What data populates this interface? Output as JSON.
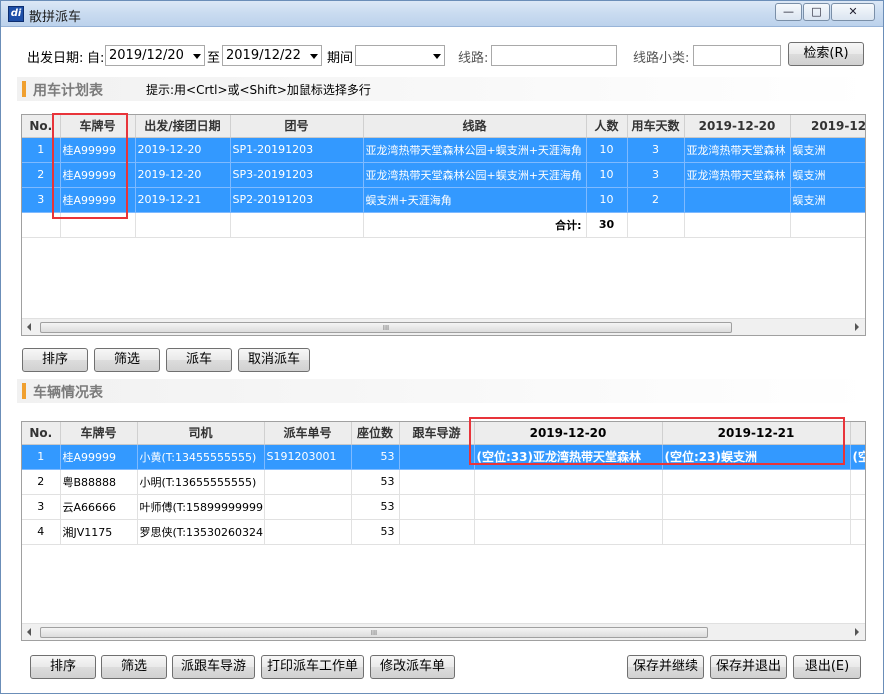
{
  "window": {
    "title": "散拼派车",
    "app_icon_text": "di",
    "minimize": "—",
    "maximize": "□",
    "close": "✕"
  },
  "filter": {
    "depart_date_label": "出发日期:",
    "from_label": "自:",
    "from_value": "2019/12/20",
    "to_label": "至",
    "to_value": "2019/12/22",
    "period_label": "期间",
    "period_value": "",
    "route_label": "线路:",
    "route_value": "",
    "route_category_label": "线路小类:",
    "route_category_value": "",
    "search_button": "检索(R)"
  },
  "plan_section": {
    "title": "用车计划表",
    "hint": "提示:用<Crtl>或<Shift>加鼠标选择多行",
    "columns": [
      "No.",
      "车牌号",
      "出发/接团日期",
      "团号",
      "线路",
      "人数",
      "用车天数",
      "2019-12-20",
      "2019-12-"
    ],
    "rows": [
      {
        "no": "1",
        "plate": "桂A99999",
        "date": "2019-12-20",
        "group": "SP1-20191203",
        "route": "亚龙湾热带天堂森林公园+蜈支洲+天涯海角",
        "people": "10",
        "days": "3",
        "d1": "亚龙湾热带天堂森林",
        "d2": "蜈支洲"
      },
      {
        "no": "2",
        "plate": "桂A99999",
        "date": "2019-12-20",
        "group": "SP3-20191203",
        "route": "亚龙湾热带天堂森林公园+蜈支洲+天涯海角",
        "people": "10",
        "days": "3",
        "d1": "亚龙湾热带天堂森林",
        "d2": "蜈支洲"
      },
      {
        "no": "3",
        "plate": "桂A99999",
        "date": "2019-12-21",
        "group": "SP2-20191203",
        "route": "蜈支洲+天涯海角",
        "people": "10",
        "days": "2",
        "d1": "",
        "d2": "蜈支洲"
      }
    ],
    "total_label": "合计:",
    "total_value": "30",
    "buttons": {
      "sort": "排序",
      "filter": "筛选",
      "dispatch": "派车",
      "cancel_dispatch": "取消派车"
    }
  },
  "vehicle_section": {
    "title": "车辆情况表",
    "columns": [
      "No.",
      "车牌号",
      "司机",
      "派车单号",
      "座位数",
      "跟车导游",
      "2019-12-20",
      "2019-12-21"
    ],
    "rows": [
      {
        "no": "1",
        "plate": "桂A99999",
        "driver": "小黄(T:13455555555)",
        "order": "S191203001",
        "seats": "53",
        "guide": "",
        "d1": "(空位:33)亚龙湾热带天堂森林",
        "d2": "(空位:23)蜈支洲",
        "d3": "(空"
      },
      {
        "no": "2",
        "plate": "粤B88888",
        "driver": "小明(T:13655555555)",
        "order": "",
        "seats": "53",
        "guide": "",
        "d1": "",
        "d2": "",
        "d3": ""
      },
      {
        "no": "3",
        "plate": "云A66666",
        "driver": "叶师傅(T:15899999999)",
        "order": "",
        "seats": "53",
        "guide": "",
        "d1": "",
        "d2": "",
        "d3": ""
      },
      {
        "no": "4",
        "plate": "湘JV1175",
        "driver": "罗思侠(T:13530260324)",
        "order": "",
        "seats": "53",
        "guide": "",
        "d1": "",
        "d2": "",
        "d3": ""
      }
    ],
    "scroll_grip": "III"
  },
  "bottom_buttons": {
    "sort": "排序",
    "filter": "筛选",
    "assign_guide": "派跟车导游",
    "print_order": "打印派车工作单",
    "modify_order": "修改派车单",
    "save_continue": "保存并继续",
    "save_exit": "保存并退出",
    "exit": "退出(E)"
  },
  "colors": {
    "selected_row": "#3399ff",
    "highlight_box": "#e8343a",
    "section_bar": "#f0a030"
  }
}
